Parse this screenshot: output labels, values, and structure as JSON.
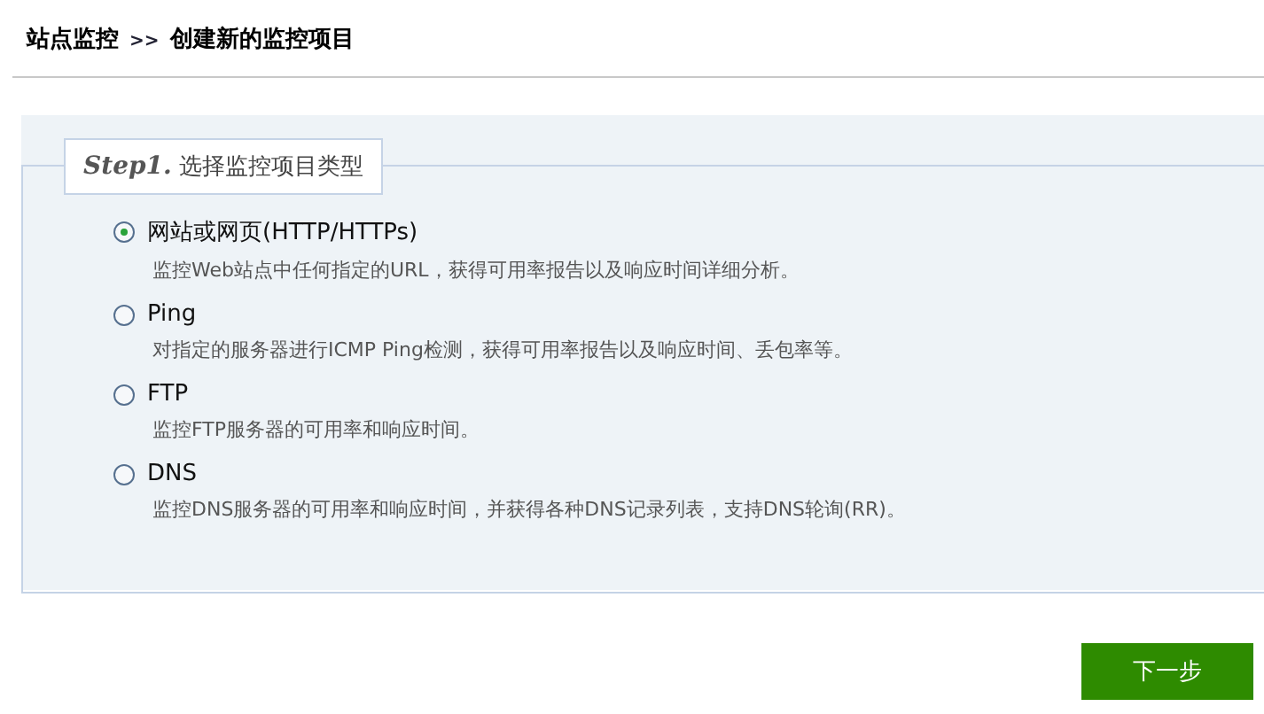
{
  "breadcrumb": {
    "parent": "站点监控",
    "separator": ">>",
    "current": "创建新的监控项目"
  },
  "section": {
    "step": "Step1.",
    "title": "选择监控项目类型"
  },
  "options": [
    {
      "label": "网站或网页(HTTP/HTTPs)",
      "description": "监控Web站点中任何指定的URL，获得可用率报告以及响应时间详细分析。",
      "selected": true
    },
    {
      "label": "Ping",
      "description": "对指定的服务器进行ICMP Ping检测，获得可用率报告以及响应时间、丢包率等。",
      "selected": false
    },
    {
      "label": "FTP",
      "description": "监控FTP服务器的可用率和响应时间。",
      "selected": false
    },
    {
      "label": "DNS",
      "description": "监控DNS服务器的可用率和响应时间，并获得各种DNS记录列表，支持DNS轮询(RR)。",
      "selected": false
    }
  ],
  "next_button": "下一步"
}
